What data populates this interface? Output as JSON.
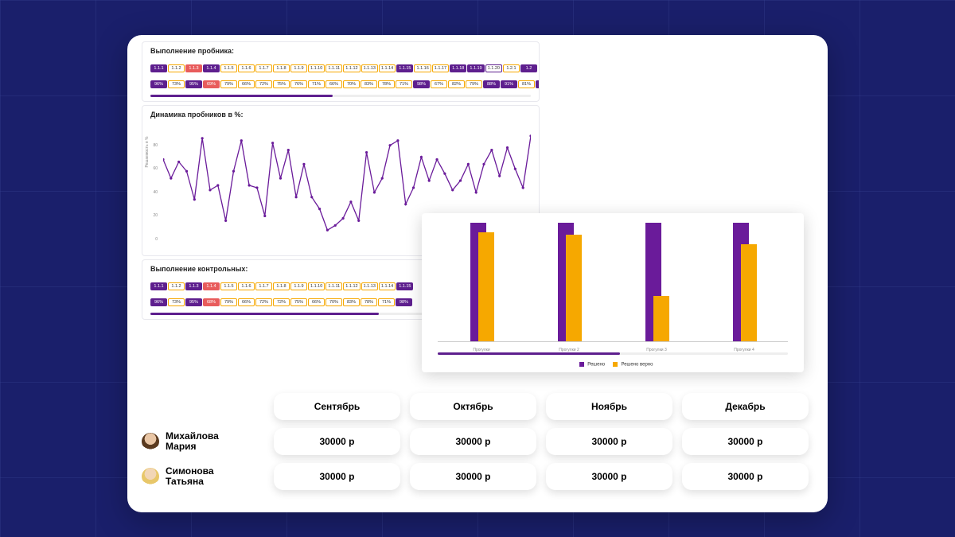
{
  "panels": {
    "probe": {
      "title": "Выполнение пробника:",
      "row1": [
        {
          "t": "1.1.1",
          "c": "purple"
        },
        {
          "t": "1.1.2",
          "c": "yellow"
        },
        {
          "t": "1.1.3",
          "c": "red"
        },
        {
          "t": "1.1.4",
          "c": "purple"
        },
        {
          "t": "1.1.5",
          "c": "yellow"
        },
        {
          "t": "1.1.6",
          "c": "yellow"
        },
        {
          "t": "1.1.7",
          "c": "yellow"
        },
        {
          "t": "1.1.8",
          "c": "yellow"
        },
        {
          "t": "1.1.9",
          "c": "yellow"
        },
        {
          "t": "1.1.10",
          "c": "yellow"
        },
        {
          "t": "1.1.11",
          "c": "yellow"
        },
        {
          "t": "1.1.12",
          "c": "yellow"
        },
        {
          "t": "1.1.13",
          "c": "yellow"
        },
        {
          "t": "1.1.14",
          "c": "yellow"
        },
        {
          "t": "1.1.15",
          "c": "purple"
        },
        {
          "t": "1.1.16",
          "c": "yellow"
        },
        {
          "t": "1.1.17",
          "c": "yellow"
        },
        {
          "t": "1.1.18",
          "c": "purple"
        },
        {
          "t": "1.1.19",
          "c": "purple"
        },
        {
          "t": "1.1.20",
          "c": "outlineP"
        },
        {
          "t": "1.2.1",
          "c": "yellow"
        },
        {
          "t": "1.2",
          "c": "purple"
        }
      ],
      "row2": [
        {
          "t": "96%",
          "c": "purple"
        },
        {
          "t": "73%",
          "c": "yellow"
        },
        {
          "t": "95%",
          "c": "purple"
        },
        {
          "t": "69%",
          "c": "red"
        },
        {
          "t": "79%",
          "c": "yellow"
        },
        {
          "t": "66%",
          "c": "yellow"
        },
        {
          "t": "72%",
          "c": "yellow"
        },
        {
          "t": "75%",
          "c": "yellow"
        },
        {
          "t": "76%",
          "c": "yellow"
        },
        {
          "t": "71%",
          "c": "yellow"
        },
        {
          "t": "66%",
          "c": "yellow"
        },
        {
          "t": "70%",
          "c": "yellow"
        },
        {
          "t": "83%",
          "c": "yellow"
        },
        {
          "t": "78%",
          "c": "yellow"
        },
        {
          "t": "71%",
          "c": "yellow"
        },
        {
          "t": "98%",
          "c": "purple"
        },
        {
          "t": "67%",
          "c": "yellow"
        },
        {
          "t": "82%",
          "c": "yellow"
        },
        {
          "t": "79%",
          "c": "yellow"
        },
        {
          "t": "88%",
          "c": "purple"
        },
        {
          "t": "91%",
          "c": "purple"
        },
        {
          "t": "81%",
          "c": "yellow"
        },
        {
          "t": "9",
          "c": "purple"
        }
      ]
    },
    "dynamics": {
      "title": "Динамика пробников в %:",
      "ylabel": "Решаемость в %"
    },
    "controls": {
      "title": "Выполнение контрольных:",
      "row1": [
        {
          "t": "1.1.1",
          "c": "purple"
        },
        {
          "t": "1.1.2",
          "c": "yellow"
        },
        {
          "t": "1.1.3",
          "c": "purple"
        },
        {
          "t": "1.1.4",
          "c": "red"
        },
        {
          "t": "1.1.5",
          "c": "yellow"
        },
        {
          "t": "1.1.6",
          "c": "yellow"
        },
        {
          "t": "1.1.7",
          "c": "yellow"
        },
        {
          "t": "1.1.8",
          "c": "yellow"
        },
        {
          "t": "1.1.9",
          "c": "yellow"
        },
        {
          "t": "1.1.10",
          "c": "yellow"
        },
        {
          "t": "1.1.11",
          "c": "yellow"
        },
        {
          "t": "1.1.12",
          "c": "yellow"
        },
        {
          "t": "1.1.13",
          "c": "yellow"
        },
        {
          "t": "1.1.14",
          "c": "yellow"
        },
        {
          "t": "1.1.15",
          "c": "purple"
        }
      ],
      "row2": [
        {
          "t": "96%",
          "c": "purple"
        },
        {
          "t": "73%",
          "c": "yellow"
        },
        {
          "t": "95%",
          "c": "purple"
        },
        {
          "t": "68%",
          "c": "red"
        },
        {
          "t": "79%",
          "c": "yellow"
        },
        {
          "t": "66%",
          "c": "yellow"
        },
        {
          "t": "72%",
          "c": "yellow"
        },
        {
          "t": "72%",
          "c": "yellow"
        },
        {
          "t": "75%",
          "c": "yellow"
        },
        {
          "t": "66%",
          "c": "yellow"
        },
        {
          "t": "70%",
          "c": "yellow"
        },
        {
          "t": "83%",
          "c": "yellow"
        },
        {
          "t": "78%",
          "c": "yellow"
        },
        {
          "t": "71%",
          "c": "yellow"
        },
        {
          "t": "98%",
          "c": "purple"
        }
      ]
    }
  },
  "bar": {
    "legend": {
      "a": "Решено",
      "b": "Решено верно"
    }
  },
  "table": {
    "months": [
      "Сентябрь",
      "Октябрь",
      "Ноябрь",
      "Декабрь"
    ],
    "people": [
      {
        "name": "Михайлова\nМария",
        "values": [
          "30000 р",
          "30000 р",
          "30000 р",
          "30000 р"
        ]
      },
      {
        "name": "Симонова\nТатьяна",
        "values": [
          "30000 р",
          "30000 р",
          "30000 р",
          "30000 р"
        ]
      }
    ]
  },
  "chart_data": [
    {
      "type": "line",
      "title": "Динамика пробников в %:",
      "ylabel": "Решаемость в %",
      "ylim": [
        0,
        100
      ],
      "y_ticks": [
        0,
        20,
        40,
        60,
        80
      ],
      "x": [
        1,
        2,
        3,
        4,
        5,
        6,
        7,
        8,
        9,
        10,
        11,
        12,
        13,
        14,
        15,
        16,
        17,
        18,
        19,
        20,
        21,
        22,
        23,
        24,
        25,
        26,
        27,
        28,
        29,
        30,
        31,
        32,
        33,
        34,
        35,
        36,
        37,
        38,
        39,
        40,
        41,
        42,
        43,
        44,
        45,
        46,
        47,
        48
      ],
      "values": [
        72,
        56,
        70,
        62,
        38,
        90,
        46,
        50,
        20,
        62,
        88,
        50,
        48,
        24,
        86,
        56,
        80,
        40,
        68,
        40,
        30,
        12,
        16,
        22,
        36,
        20,
        78,
        44,
        56,
        84,
        88,
        34,
        48,
        74,
        54,
        72,
        60,
        46,
        54,
        68,
        44,
        68,
        80,
        58,
        82,
        64,
        48,
        92
      ]
    },
    {
      "type": "bar",
      "title": "",
      "categories": [
        "Прогулки",
        "Прогулки 2",
        "Прогулки 3",
        "Прогулки 4"
      ],
      "series": [
        {
          "name": "Решено",
          "values": [
            100,
            100,
            100,
            100
          ]
        },
        {
          "name": "Решено верно",
          "values": [
            92,
            90,
            38,
            82
          ]
        }
      ],
      "ylim": [
        0,
        100
      ],
      "colors": {
        "Решено": "#6a1b9a",
        "Решено верно": "#f6a800"
      }
    }
  ]
}
